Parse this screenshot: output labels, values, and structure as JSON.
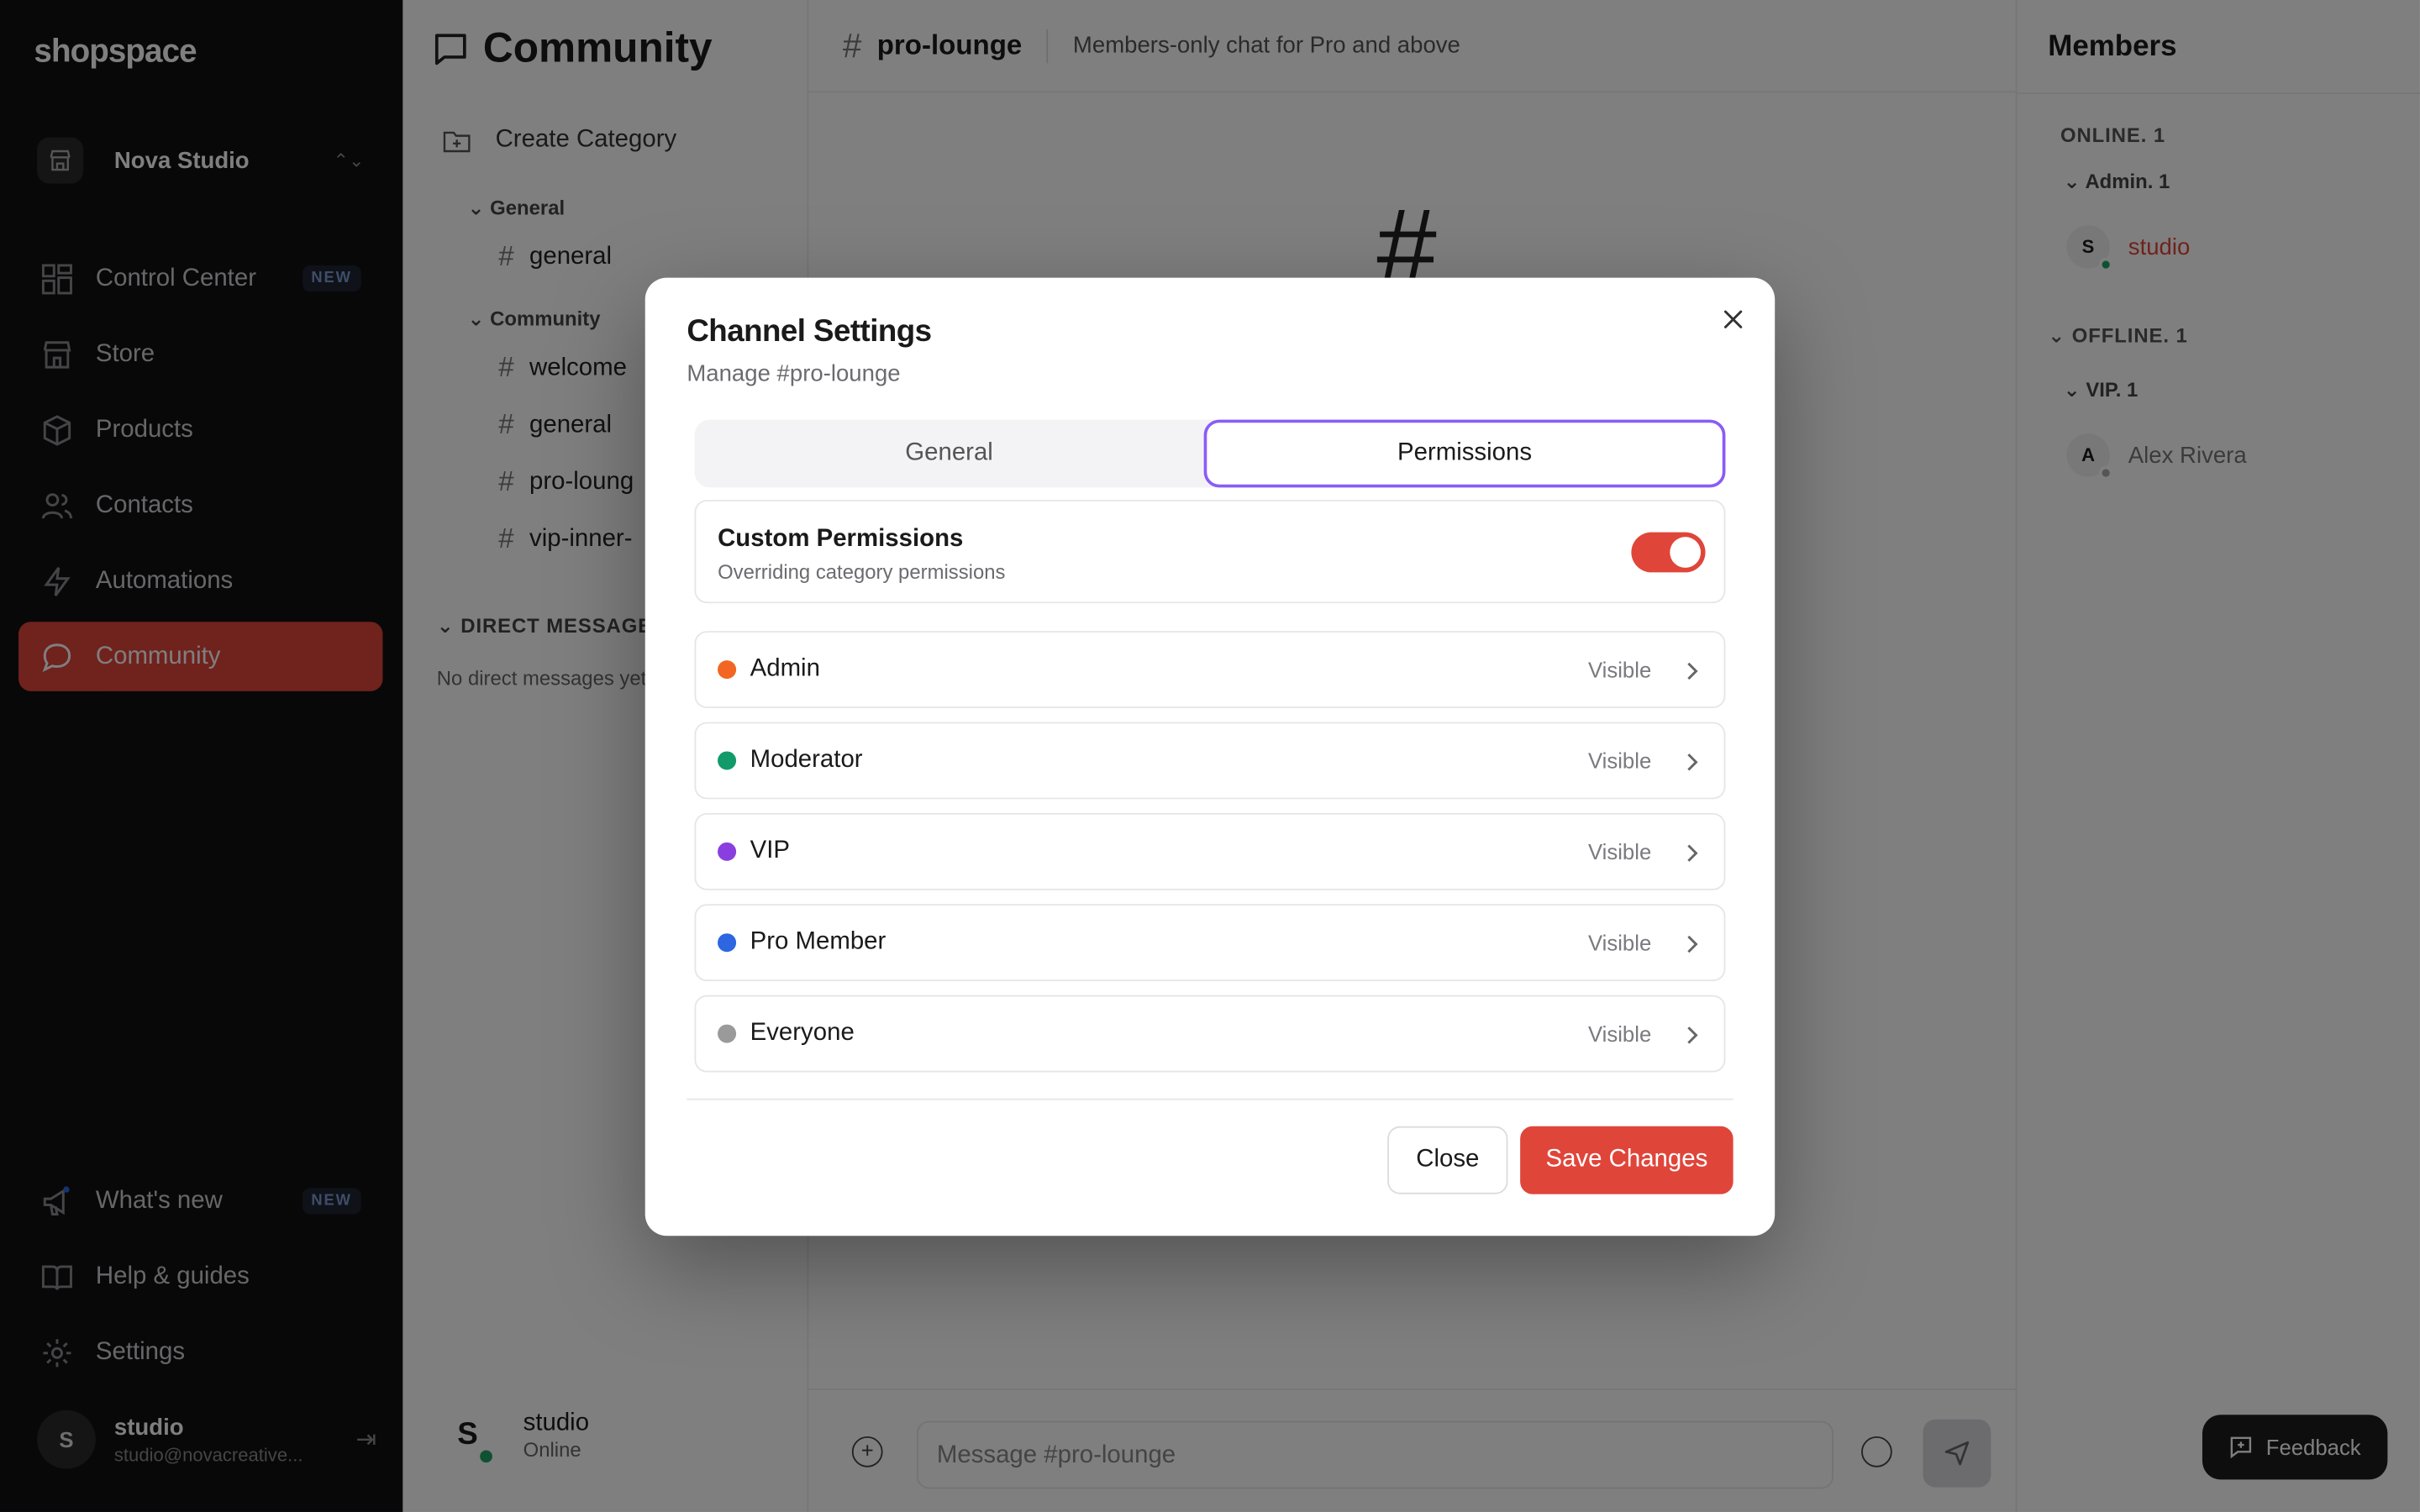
{
  "app": {
    "logo": "shopspace"
  },
  "sidebar": {
    "store_name": "Nova Studio",
    "nav": [
      {
        "label": "Control Center",
        "icon": "dashboard-icon",
        "badge": "NEW"
      },
      {
        "label": "Store",
        "icon": "store-icon"
      },
      {
        "label": "Products",
        "icon": "box-icon"
      },
      {
        "label": "Contacts",
        "icon": "users-icon"
      },
      {
        "label": "Automations",
        "icon": "bolt-icon"
      },
      {
        "label": "Community",
        "icon": "chat-icon",
        "active": true
      }
    ],
    "bottom_nav": [
      {
        "label": "What's new",
        "icon": "megaphone-icon",
        "badge": "NEW"
      },
      {
        "label": "Help & guides",
        "icon": "book-icon"
      },
      {
        "label": "Settings",
        "icon": "gear-icon"
      }
    ],
    "user": {
      "initial": "S",
      "name": "studio",
      "email": "studio@novacreative..."
    }
  },
  "channels": {
    "title": "Community",
    "create_category": "Create Category",
    "categories": [
      {
        "name": "General",
        "channels": [
          "general"
        ]
      },
      {
        "name": "Community",
        "channels": [
          "welcome",
          "general",
          "pro-loung",
          "vip-inner-"
        ]
      }
    ],
    "dm_header": "DIRECT MESSAGES",
    "dm_empty": "No direct messages yet",
    "me": {
      "initial": "S",
      "name": "studio",
      "status": "Online"
    }
  },
  "main": {
    "channel_name": "pro-lounge",
    "description": "Members-only chat for Pro and above",
    "hash": "#",
    "composer_placeholder": "Message #pro-lounge"
  },
  "members": {
    "title": "Members",
    "online_label": "ONLINE. 1",
    "online_role": "Admin. 1",
    "online_member": {
      "initial": "S",
      "name": "studio",
      "color": "#e0453a"
    },
    "offline_label": "OFFLINE. 1",
    "offline_role": "VIP. 1",
    "offline_member": {
      "initial": "A",
      "name": "Alex Rivera"
    },
    "feedback": "Feedback"
  },
  "modal": {
    "title": "Channel Settings",
    "subtitle": "Manage #pro-lounge",
    "tabs": {
      "general": "General",
      "permissions": "Permissions"
    },
    "custom_permissions": {
      "title": "Custom Permissions",
      "subtitle": "Overriding category permissions",
      "enabled": true
    },
    "roles": [
      {
        "name": "Admin",
        "visibility": "Visible",
        "color": "#f26522"
      },
      {
        "name": "Moderator",
        "visibility": "Visible",
        "color": "#139a6b"
      },
      {
        "name": "VIP",
        "visibility": "Visible",
        "color": "#8b3ee0"
      },
      {
        "name": "Pro Member",
        "visibility": "Visible",
        "color": "#2d66e0"
      },
      {
        "name": "Everyone",
        "visibility": "Visible",
        "color": "#9a9a9a"
      }
    ],
    "close_label": "Close",
    "save_label": "Save Changes"
  },
  "colors": {
    "accent": "#e0453a",
    "tab_focus": "#8b5cf6"
  }
}
